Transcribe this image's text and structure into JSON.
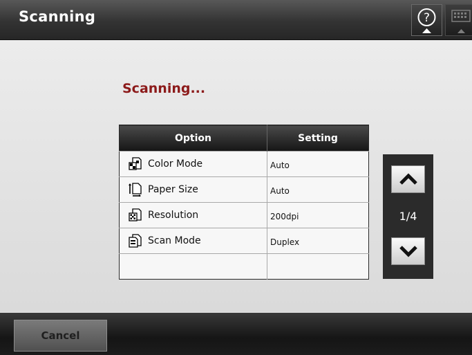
{
  "app": {
    "title": "Scanning"
  },
  "header": {
    "help_icon": "help-icon",
    "keyboard_icon": "keyboard-icon"
  },
  "status": {
    "text": "Scanning..."
  },
  "table": {
    "columns": [
      "Option",
      "Setting"
    ],
    "rows": [
      {
        "label": "Color Mode",
        "value": "Auto",
        "icon": "color-mode-icon"
      },
      {
        "label": "Paper Size",
        "value": "Auto",
        "icon": "paper-size-icon"
      },
      {
        "label": "Resolution",
        "value": "200dpi",
        "icon": "resolution-icon"
      },
      {
        "label": "Scan Mode",
        "value": "Duplex",
        "icon": "scan-mode-icon"
      },
      {
        "label": "",
        "value": ""
      }
    ]
  },
  "pager": {
    "page": "1/4",
    "up_icon": "chevron-up-icon",
    "down_icon": "chevron-down-icon"
  },
  "footer": {
    "cancel_label": "Cancel"
  }
}
